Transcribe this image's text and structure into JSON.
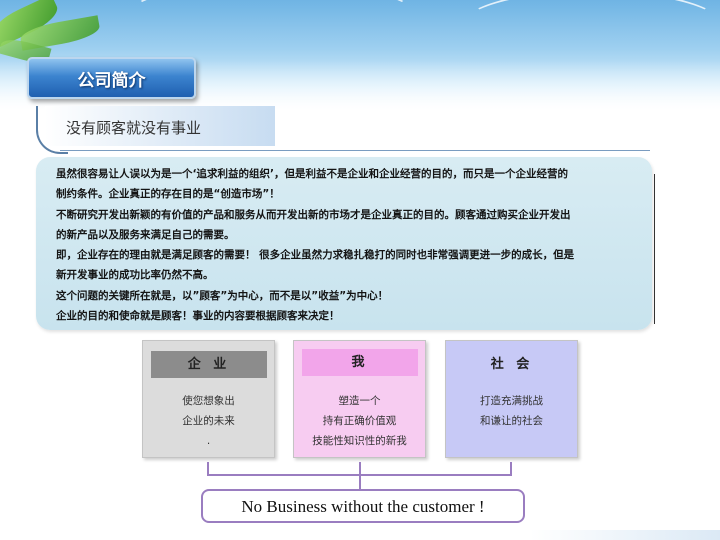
{
  "header": {
    "title": "公司简介"
  },
  "subtitle": "没有顾客就没有事业",
  "panel": {
    "lines": [
      "虽然很容易让人误以为是一个‘追求利益的组织’，但是利益不是企业和企业经营的目的，而只是一个企业经营的",
      "制约条件。企业真正的存在目的是“创造市场”！",
      "不断研究开发出新颖的有价值的产品和服务从而开发出新的市场才是企业真正的目的。顾客通过购买企业开发出",
      "的新产品以及服务来满足自己的需要。",
      "即，企业存在的理由就是满足顾客的需要！   很多企业虽然力求稳扎稳打的同时也非常强调更进一步的成长，但是",
      "新开发事业的成功比率仍然不高。",
      "这个问题的关键所在就是，以”顾客”为中心，而不是以”收益”为中心！",
      "企业的目的和使命就是顾客！事业的内容要根据顾客来决定！"
    ]
  },
  "columns": [
    {
      "head": "企 业",
      "body": [
        "使您想象出",
        "企业的未来",
        "."
      ],
      "bg": "#dcdcdc",
      "headBg": "#8c8c8c",
      "headColor": "#222222"
    },
    {
      "head": "我",
      "body": [
        "塑造一个",
        "持有正确价值观",
        "技能性知识性的新我"
      ],
      "bg": "#f7ccf1",
      "headBg": "#f2a5ea",
      "headColor": "#222222"
    },
    {
      "head": "社 会",
      "body": [
        "打造充满挑战",
        "和谦让的社会"
      ],
      "bg": "#c7c9f6",
      "headBg": "#c7c9f6",
      "headColor": "#222222"
    }
  ],
  "slogan": "No Business without the customer !"
}
